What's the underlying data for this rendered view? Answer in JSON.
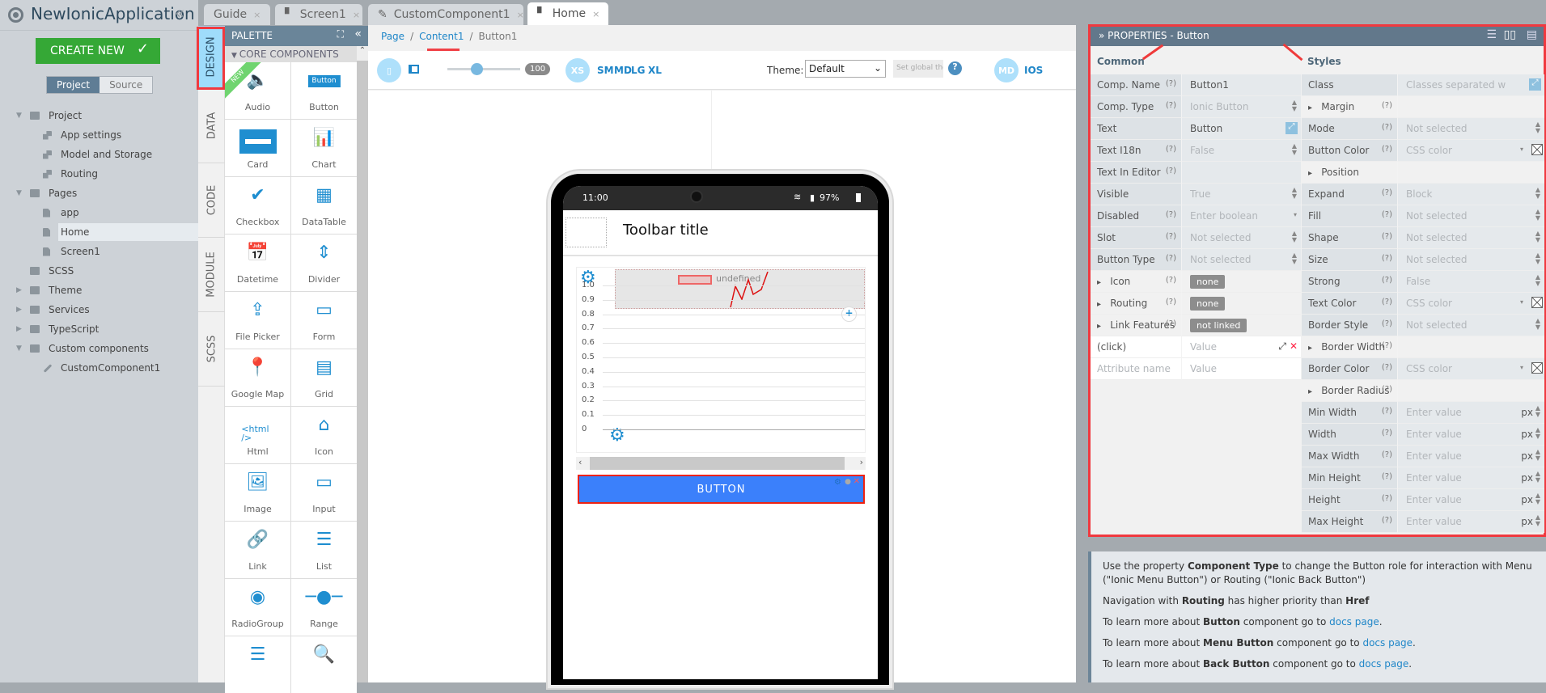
{
  "app": {
    "title": "NewIonicApplication",
    "create_new": "CREATE NEW",
    "toggle": [
      "Project",
      "Source"
    ]
  },
  "tree": [
    {
      "label": "Project",
      "level": 0,
      "icon": "folder",
      "caret": "down"
    },
    {
      "label": "App settings",
      "level": 1,
      "icon": "settings"
    },
    {
      "label": "Model and Storage",
      "level": 1,
      "icon": "settings"
    },
    {
      "label": "Routing",
      "level": 1,
      "icon": "settings"
    },
    {
      "label": "Pages",
      "level": 0,
      "icon": "folder",
      "caret": "down"
    },
    {
      "label": "app",
      "level": 1,
      "icon": "file"
    },
    {
      "label": "Home",
      "level": 1,
      "icon": "file",
      "selected": true
    },
    {
      "label": "Screen1",
      "level": 1,
      "icon": "file"
    },
    {
      "label": "SCSS",
      "level": 0,
      "icon": "folder"
    },
    {
      "label": "Theme",
      "level": 0,
      "icon": "folder",
      "caret": "right"
    },
    {
      "label": "Services",
      "level": 0,
      "icon": "folder",
      "caret": "right"
    },
    {
      "label": "TypeScript",
      "level": 0,
      "icon": "folder",
      "caret": "right"
    },
    {
      "label": "Custom components",
      "level": 0,
      "icon": "folder",
      "caret": "down"
    },
    {
      "label": "CustomComponent1",
      "level": 1,
      "icon": "pencil"
    }
  ],
  "tabs": [
    {
      "label": "Guide"
    },
    {
      "label": "Screen1",
      "icon": "file"
    },
    {
      "label": "CustomComponent1",
      "icon": "pencil"
    },
    {
      "label": "Home",
      "icon": "file",
      "active": true
    }
  ],
  "vtabs": [
    "DESIGN",
    "DATA",
    "CODE",
    "MODULE",
    "SCSS"
  ],
  "palette": {
    "title": "PALETTE",
    "section": "CORE COMPONENTS",
    "new_badge": "NEW",
    "items": [
      {
        "label": "Audio",
        "icon": "🔈"
      },
      {
        "label": "Button",
        "icon": "button"
      },
      {
        "label": "Card",
        "icon": "card"
      },
      {
        "label": "Chart",
        "icon": "📊"
      },
      {
        "label": "Checkbox",
        "icon": "✔"
      },
      {
        "label": "DataTable",
        "icon": "▦"
      },
      {
        "label": "Datetime",
        "icon": "📅"
      },
      {
        "label": "Divider",
        "icon": "⇕"
      },
      {
        "label": "File Picker",
        "icon": "⇪"
      },
      {
        "label": "Form",
        "icon": "▭"
      },
      {
        "label": "Google Map",
        "icon": "📍"
      },
      {
        "label": "Grid",
        "icon": "▤"
      },
      {
        "label": "Html",
        "icon": "<html />"
      },
      {
        "label": "Icon",
        "icon": "⌂"
      },
      {
        "label": "Image",
        "icon": "🖼"
      },
      {
        "label": "Input",
        "icon": "▭"
      },
      {
        "label": "Link",
        "icon": "🔗"
      },
      {
        "label": "List",
        "icon": "☰"
      },
      {
        "label": "RadioGroup",
        "icon": "◉"
      },
      {
        "label": "Range",
        "icon": "─●─"
      },
      {
        "label": "",
        "icon": "☰"
      },
      {
        "label": "",
        "icon": "🔍"
      }
    ],
    "button_icon_text": "Button"
  },
  "breadcrumb": [
    "Page",
    "Content1",
    "Button1"
  ],
  "toolbar": {
    "zoom": "100",
    "zoom_fraction": 0.4,
    "breakpoints": [
      "XS",
      "SM",
      "MD",
      "LG",
      "XL"
    ],
    "theme_label": "Theme:",
    "theme_value": "Default",
    "set_global": "Set global theme",
    "modes": [
      "MD",
      "IOS"
    ]
  },
  "phone": {
    "time": "11:00",
    "battery": "97%",
    "toolbar_title": "Toolbar title",
    "button_text": "BUTTON",
    "chart": {
      "legend": "undefined",
      "y_ticks": [
        "1.0",
        "0.9",
        "0.8",
        "0.7",
        "0.6",
        "0.5",
        "0.4",
        "0.3",
        "0.2",
        "0.1",
        "0"
      ]
    }
  },
  "properties": {
    "title": "PROPERTIES - Button",
    "common_title": "Common",
    "styles_title": "Styles",
    "common": [
      {
        "label": "Comp. Name",
        "help": "(?)",
        "value": "Button1"
      },
      {
        "label": "Comp. Type",
        "help": "(?)",
        "value": "Ionic Button",
        "muted": true,
        "ctrl": "spin"
      },
      {
        "label": "Text",
        "value": "Button",
        "ctrl": "expand"
      },
      {
        "label": "Text I18n",
        "help": "(?)",
        "value": "False",
        "muted": true,
        "ctrl": "spin"
      },
      {
        "label": "Text In Editor",
        "help": "(?)",
        "value": ""
      },
      {
        "label": "Visible",
        "value": "True",
        "muted": true,
        "ctrl": "spin"
      },
      {
        "label": "Disabled",
        "help": "(?)",
        "value": "Enter boolean",
        "muted": true,
        "ctrl": "drop"
      },
      {
        "label": "Slot",
        "help": "(?)",
        "value": "Not selected",
        "muted": true,
        "ctrl": "spin"
      },
      {
        "label": "Button Type",
        "help": "(?)",
        "value": "Not selected",
        "muted": true,
        "ctrl": "spin"
      },
      {
        "label": "Icon",
        "help": "(?)",
        "badge": "none",
        "open": true
      },
      {
        "label": "Routing",
        "help": "(?)",
        "badge": "none",
        "open": true
      },
      {
        "label": "Link Features",
        "help": "(?)",
        "badge": "not linked",
        "open": true
      },
      {
        "label": "(click)",
        "value": "Value",
        "muted": true,
        "white": true,
        "ctrl": "clickctl"
      },
      {
        "label": "Attribute name",
        "value": "Value",
        "muted": true,
        "white": true,
        "labmuted": true
      }
    ],
    "styles": [
      {
        "label": "Class",
        "value": "Classes separated w",
        "muted": true,
        "ctrl": "expand"
      },
      {
        "label": "Margin",
        "help": "(?)",
        "open": true
      },
      {
        "label": "Mode",
        "help": "(?)",
        "value": "Not selected",
        "muted": true,
        "ctrl": "spin"
      },
      {
        "label": "Button Color",
        "help": "(?)",
        "value": "CSS color",
        "muted": true,
        "ctrl": "color"
      },
      {
        "label": "Position",
        "open": true
      },
      {
        "label": "Expand",
        "help": "(?)",
        "value": "Block",
        "muted": true,
        "ctrl": "spin"
      },
      {
        "label": "Fill",
        "help": "(?)",
        "value": "Not selected",
        "muted": true,
        "ctrl": "spin"
      },
      {
        "label": "Shape",
        "help": "(?)",
        "value": "Not selected",
        "muted": true,
        "ctrl": "spin"
      },
      {
        "label": "Size",
        "help": "(?)",
        "value": "Not selected",
        "muted": true,
        "ctrl": "spin"
      },
      {
        "label": "Strong",
        "help": "(?)",
        "value": "False",
        "muted": true,
        "ctrl": "spin"
      },
      {
        "label": "Text Color",
        "help": "(?)",
        "value": "CSS color",
        "muted": true,
        "ctrl": "color"
      },
      {
        "label": "Border Style",
        "help": "(?)",
        "value": "Not selected",
        "muted": true,
        "ctrl": "spin"
      },
      {
        "label": "Border Width",
        "help": "(?)",
        "open": true
      },
      {
        "label": "Border Color",
        "help": "(?)",
        "value": "CSS color",
        "muted": true,
        "ctrl": "color"
      },
      {
        "label": "Border Radius",
        "help": "(?)",
        "open": true
      },
      {
        "label": "Min Width",
        "help": "(?)",
        "value": "Enter value",
        "muted": true,
        "ctrl": "px",
        "unit": "px"
      },
      {
        "label": "Width",
        "help": "(?)",
        "value": "Enter value",
        "muted": true,
        "ctrl": "px",
        "unit": "px"
      },
      {
        "label": "Max Width",
        "help": "(?)",
        "value": "Enter value",
        "muted": true,
        "ctrl": "px",
        "unit": "px"
      },
      {
        "label": "Min Height",
        "help": "(?)",
        "value": "Enter value",
        "muted": true,
        "ctrl": "px",
        "unit": "px"
      },
      {
        "label": "Height",
        "help": "(?)",
        "value": "Enter value",
        "muted": true,
        "ctrl": "px",
        "unit": "px"
      },
      {
        "label": "Max Height",
        "help": "(?)",
        "value": "Enter value",
        "muted": true,
        "ctrl": "px",
        "unit": "px"
      }
    ]
  },
  "help": {
    "p1": {
      "a": "Use the property ",
      "b": "Component Type",
      "c": " to change the Button role for interaction with Menu (\"Ionic Menu Button\") or Routing (\"Ionic Back Button\")"
    },
    "p2": {
      "a": "Navigation with ",
      "b": "Routing",
      "c": " has higher priority than ",
      "d": "Href"
    },
    "p3": {
      "a": "To learn more about ",
      "b": "Button",
      "c": " component go to ",
      "link": "docs page",
      "d": "."
    },
    "p4": {
      "a": "To learn more about ",
      "b": "Menu Button",
      "c": " component go to ",
      "link": "docs page",
      "d": "."
    },
    "p5": {
      "a": "To learn more about ",
      "b": "Back Button",
      "c": " component go to ",
      "link": "docs page",
      "d": "."
    }
  },
  "colors": {
    "accent": "#1f86c8",
    "create": "#35a836",
    "annotation": "#f0393f",
    "button": "#3b80fb"
  }
}
